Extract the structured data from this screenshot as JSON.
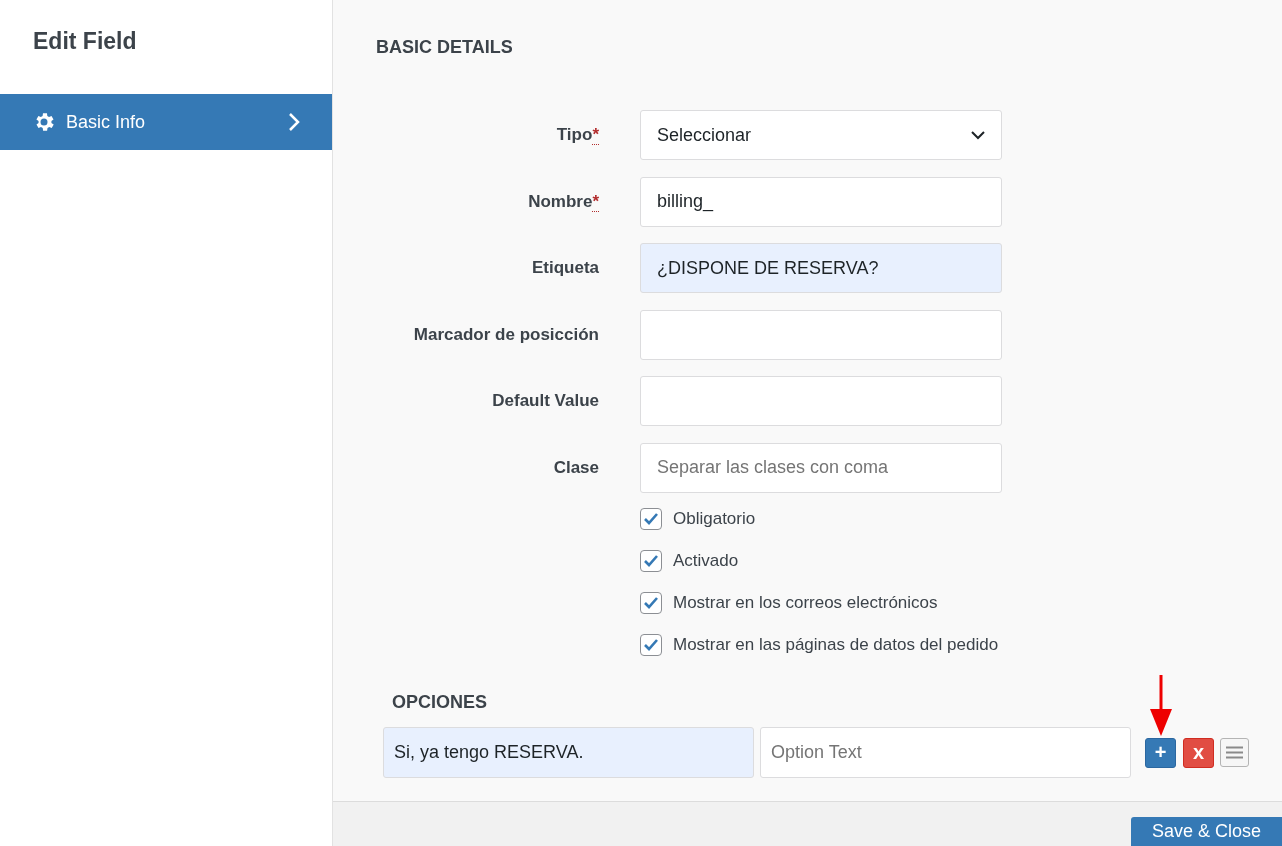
{
  "sidebar": {
    "title": "Edit Field",
    "items": [
      {
        "label": "Basic Info",
        "selected": true
      }
    ]
  },
  "section_title": "BASIC DETAILS",
  "required_mark": "*",
  "fields": [
    {
      "kind": "select",
      "label": "Tipo",
      "required": true,
      "value": "Seleccionar",
      "highlighted": false
    },
    {
      "kind": "text",
      "label": "Nombre",
      "required": true,
      "value": "billing_",
      "highlighted": false
    },
    {
      "kind": "text",
      "label": "Etiqueta",
      "required": false,
      "value": "¿DISPONE DE RESERVA?",
      "highlighted": true
    },
    {
      "kind": "text",
      "label": "Marcador de posicción",
      "required": false,
      "highlighted": false
    },
    {
      "kind": "text",
      "label": "Default Value",
      "required": false,
      "highlighted": false
    },
    {
      "kind": "text",
      "label": "Clase",
      "required": false,
      "placeholder": "Separar las clases con coma",
      "highlighted": false
    }
  ],
  "checkboxes": [
    {
      "label": "Obligatorio",
      "checked": true
    },
    {
      "label": "Activado",
      "checked": true
    },
    {
      "label": "Mostrar en los correos electrónicos",
      "checked": true
    },
    {
      "label": "Mostrar en las páginas de datos del pedido",
      "checked": true
    }
  ],
  "options": {
    "title": "OPCIONES",
    "rows": [
      {
        "value": "Si, ya tengo RESERVA.",
        "value_highlighted": true,
        "placeholder": "Option Text",
        "add_label": "+",
        "remove_label": "x"
      }
    ]
  },
  "save_button": "Save & Close"
}
